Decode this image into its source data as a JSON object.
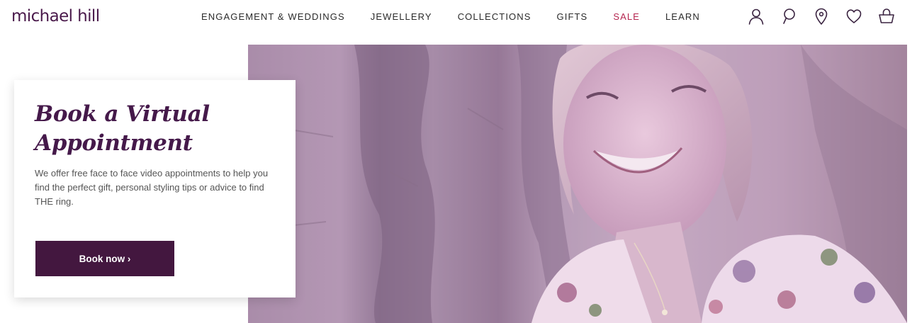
{
  "brand": {
    "logo_text": "michael hill",
    "color": "#4a1a4b"
  },
  "nav": {
    "items": [
      {
        "label": "ENGAGEMENT & WEDDINGS"
      },
      {
        "label": "JEWELLERY"
      },
      {
        "label": "COLLECTIONS"
      },
      {
        "label": "GIFTS"
      },
      {
        "label": "SALE",
        "accent_color": "#b5254f"
      },
      {
        "label": "LEARN"
      }
    ]
  },
  "header_icons": [
    "account-icon",
    "chat-icon",
    "store-locator-icon",
    "wishlist-icon",
    "cart-icon"
  ],
  "hero": {
    "title": "Book a Virtual Appointment",
    "description": "We offer free face to face video appointments to help you find the perfect gift, personal styling tips or advice to find THE ring.",
    "button_label": "Book now ›",
    "button_color": "#43173f",
    "image_subject": "smiling woman with blonde hair in floral top against stone wall, purple tint"
  }
}
